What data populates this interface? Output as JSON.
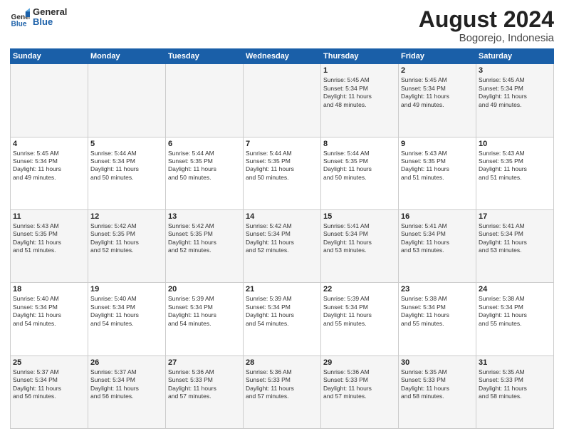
{
  "logo": {
    "line1": "General",
    "line2": "Blue"
  },
  "title": "August 2024",
  "subtitle": "Bogorejo, Indonesia",
  "days": [
    "Sunday",
    "Monday",
    "Tuesday",
    "Wednesday",
    "Thursday",
    "Friday",
    "Saturday"
  ],
  "weeks": [
    [
      {
        "day": "",
        "content": ""
      },
      {
        "day": "",
        "content": ""
      },
      {
        "day": "",
        "content": ""
      },
      {
        "day": "",
        "content": ""
      },
      {
        "day": "1",
        "content": "Sunrise: 5:45 AM\nSunset: 5:34 PM\nDaylight: 11 hours\nand 48 minutes."
      },
      {
        "day": "2",
        "content": "Sunrise: 5:45 AM\nSunset: 5:34 PM\nDaylight: 11 hours\nand 49 minutes."
      },
      {
        "day": "3",
        "content": "Sunrise: 5:45 AM\nSunset: 5:34 PM\nDaylight: 11 hours\nand 49 minutes."
      }
    ],
    [
      {
        "day": "4",
        "content": "Sunrise: 5:45 AM\nSunset: 5:34 PM\nDaylight: 11 hours\nand 49 minutes."
      },
      {
        "day": "5",
        "content": "Sunrise: 5:44 AM\nSunset: 5:34 PM\nDaylight: 11 hours\nand 50 minutes."
      },
      {
        "day": "6",
        "content": "Sunrise: 5:44 AM\nSunset: 5:35 PM\nDaylight: 11 hours\nand 50 minutes."
      },
      {
        "day": "7",
        "content": "Sunrise: 5:44 AM\nSunset: 5:35 PM\nDaylight: 11 hours\nand 50 minutes."
      },
      {
        "day": "8",
        "content": "Sunrise: 5:44 AM\nSunset: 5:35 PM\nDaylight: 11 hours\nand 50 minutes."
      },
      {
        "day": "9",
        "content": "Sunrise: 5:43 AM\nSunset: 5:35 PM\nDaylight: 11 hours\nand 51 minutes."
      },
      {
        "day": "10",
        "content": "Sunrise: 5:43 AM\nSunset: 5:35 PM\nDaylight: 11 hours\nand 51 minutes."
      }
    ],
    [
      {
        "day": "11",
        "content": "Sunrise: 5:43 AM\nSunset: 5:35 PM\nDaylight: 11 hours\nand 51 minutes."
      },
      {
        "day": "12",
        "content": "Sunrise: 5:42 AM\nSunset: 5:35 PM\nDaylight: 11 hours\nand 52 minutes."
      },
      {
        "day": "13",
        "content": "Sunrise: 5:42 AM\nSunset: 5:35 PM\nDaylight: 11 hours\nand 52 minutes."
      },
      {
        "day": "14",
        "content": "Sunrise: 5:42 AM\nSunset: 5:34 PM\nDaylight: 11 hours\nand 52 minutes."
      },
      {
        "day": "15",
        "content": "Sunrise: 5:41 AM\nSunset: 5:34 PM\nDaylight: 11 hours\nand 53 minutes."
      },
      {
        "day": "16",
        "content": "Sunrise: 5:41 AM\nSunset: 5:34 PM\nDaylight: 11 hours\nand 53 minutes."
      },
      {
        "day": "17",
        "content": "Sunrise: 5:41 AM\nSunset: 5:34 PM\nDaylight: 11 hours\nand 53 minutes."
      }
    ],
    [
      {
        "day": "18",
        "content": "Sunrise: 5:40 AM\nSunset: 5:34 PM\nDaylight: 11 hours\nand 54 minutes."
      },
      {
        "day": "19",
        "content": "Sunrise: 5:40 AM\nSunset: 5:34 PM\nDaylight: 11 hours\nand 54 minutes."
      },
      {
        "day": "20",
        "content": "Sunrise: 5:39 AM\nSunset: 5:34 PM\nDaylight: 11 hours\nand 54 minutes."
      },
      {
        "day": "21",
        "content": "Sunrise: 5:39 AM\nSunset: 5:34 PM\nDaylight: 11 hours\nand 54 minutes."
      },
      {
        "day": "22",
        "content": "Sunrise: 5:39 AM\nSunset: 5:34 PM\nDaylight: 11 hours\nand 55 minutes."
      },
      {
        "day": "23",
        "content": "Sunrise: 5:38 AM\nSunset: 5:34 PM\nDaylight: 11 hours\nand 55 minutes."
      },
      {
        "day": "24",
        "content": "Sunrise: 5:38 AM\nSunset: 5:34 PM\nDaylight: 11 hours\nand 55 minutes."
      }
    ],
    [
      {
        "day": "25",
        "content": "Sunrise: 5:37 AM\nSunset: 5:34 PM\nDaylight: 11 hours\nand 56 minutes."
      },
      {
        "day": "26",
        "content": "Sunrise: 5:37 AM\nSunset: 5:34 PM\nDaylight: 11 hours\nand 56 minutes."
      },
      {
        "day": "27",
        "content": "Sunrise: 5:36 AM\nSunset: 5:33 PM\nDaylight: 11 hours\nand 57 minutes."
      },
      {
        "day": "28",
        "content": "Sunrise: 5:36 AM\nSunset: 5:33 PM\nDaylight: 11 hours\nand 57 minutes."
      },
      {
        "day": "29",
        "content": "Sunrise: 5:36 AM\nSunset: 5:33 PM\nDaylight: 11 hours\nand 57 minutes."
      },
      {
        "day": "30",
        "content": "Sunrise: 5:35 AM\nSunset: 5:33 PM\nDaylight: 11 hours\nand 58 minutes."
      },
      {
        "day": "31",
        "content": "Sunrise: 5:35 AM\nSunset: 5:33 PM\nDaylight: 11 hours\nand 58 minutes."
      }
    ]
  ]
}
